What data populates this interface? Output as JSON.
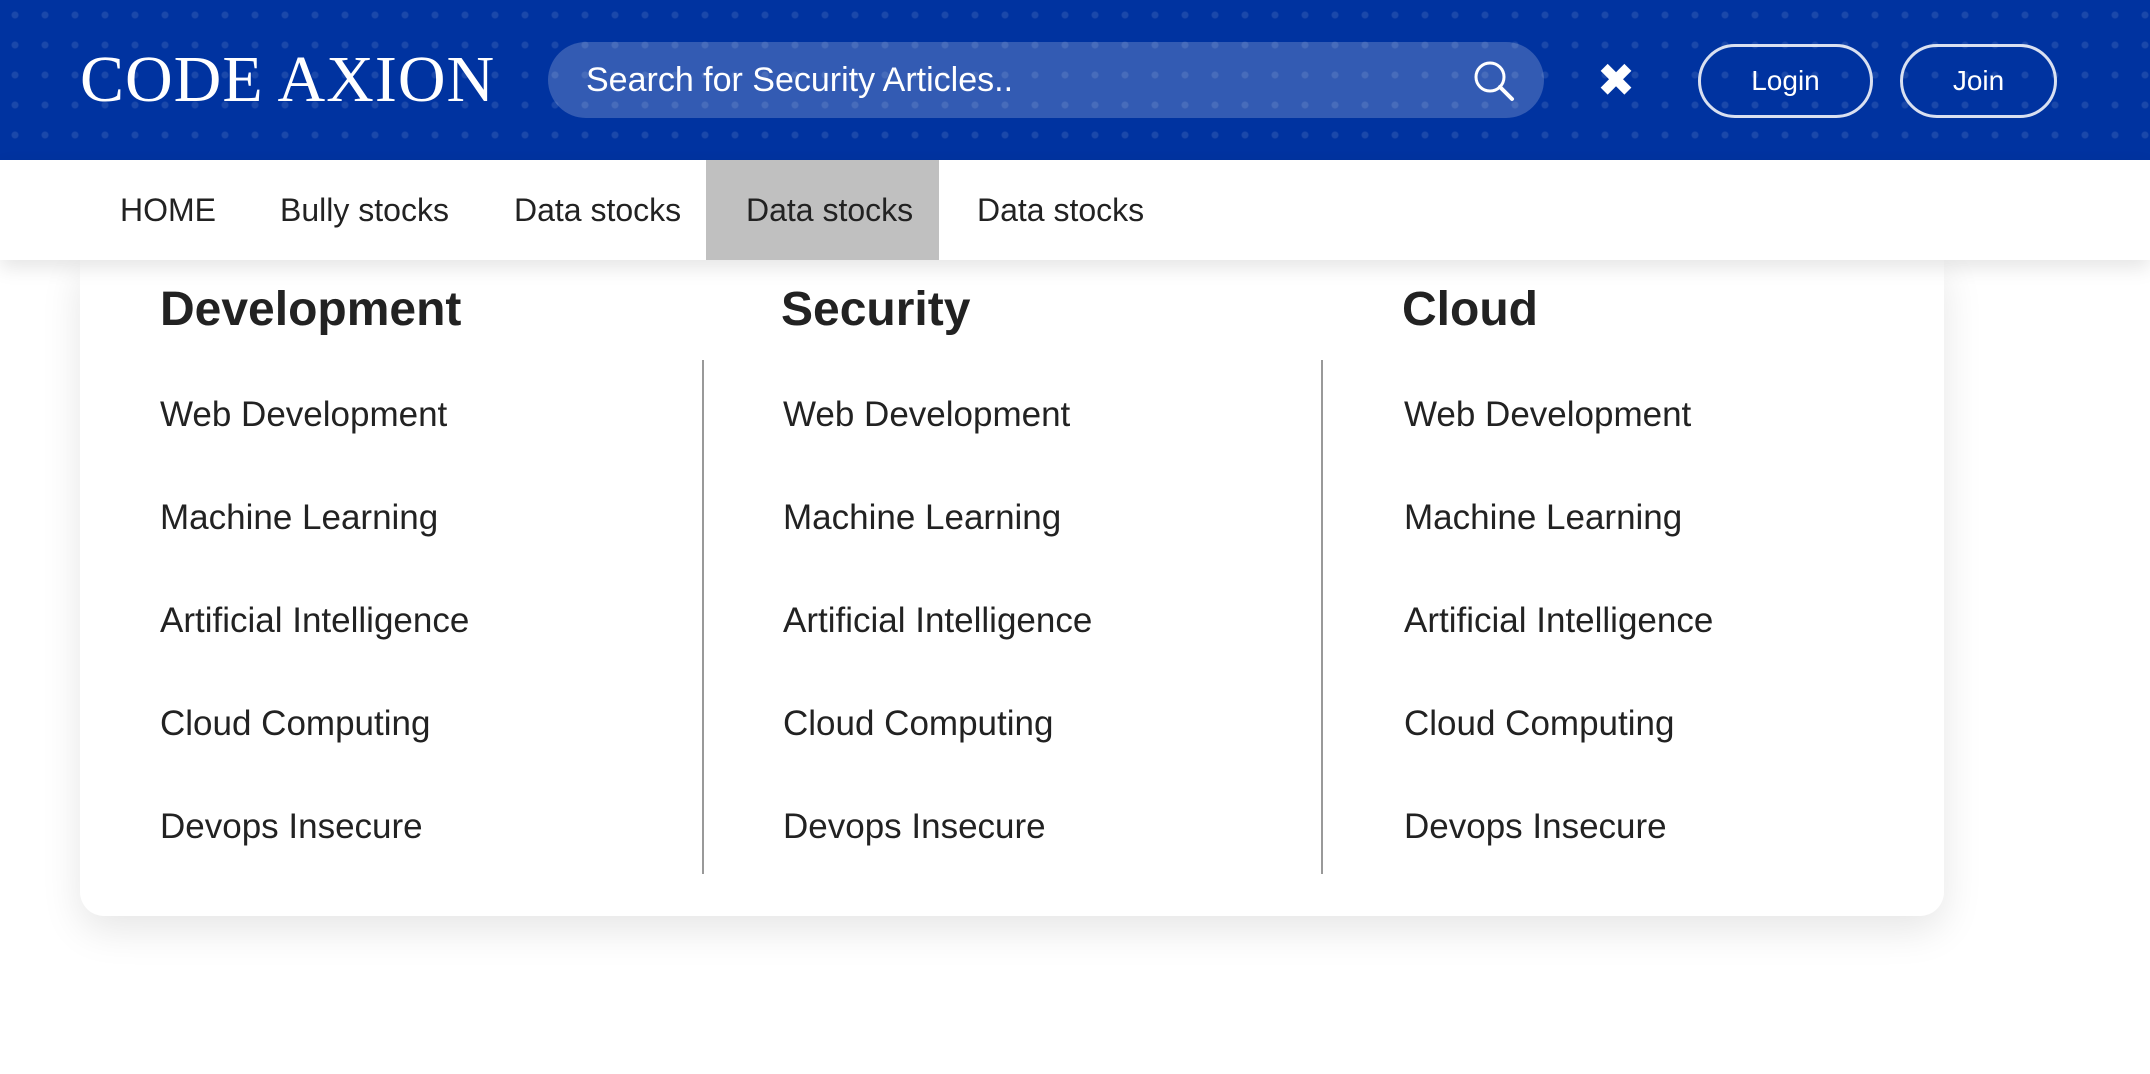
{
  "header": {
    "logo": "CODE AXION",
    "search": {
      "placeholder": "Search for Security Articles..",
      "value": ""
    },
    "close_icon": "close-icon",
    "login_label": "Login",
    "join_label": "Join"
  },
  "nav": {
    "items": [
      {
        "label": "HOME"
      },
      {
        "label": "Bully stocks"
      },
      {
        "label": "Data stocks"
      },
      {
        "label": "Data stocks"
      },
      {
        "label": "Data stocks"
      }
    ],
    "active_index": 3
  },
  "mega_menu": {
    "columns": [
      {
        "title": "Development",
        "links": [
          "Web Development",
          "Machine Learning",
          "Artificial Intelligence",
          "Cloud Computing",
          "Devops Insecure"
        ]
      },
      {
        "title": "Security",
        "links": [
          "Web Development",
          "Machine Learning",
          "Artificial Intelligence",
          "Cloud Computing",
          "Devops Insecure"
        ]
      },
      {
        "title": "Cloud",
        "links": [
          "Web Development",
          "Machine Learning",
          "Artificial Intelligence",
          "Cloud Computing",
          "Devops Insecure"
        ]
      }
    ]
  },
  "colors": {
    "header_bg": "#0033a0",
    "active_nav_bg": "#c0c0c0",
    "text": "#222222",
    "divider": "#999999"
  }
}
